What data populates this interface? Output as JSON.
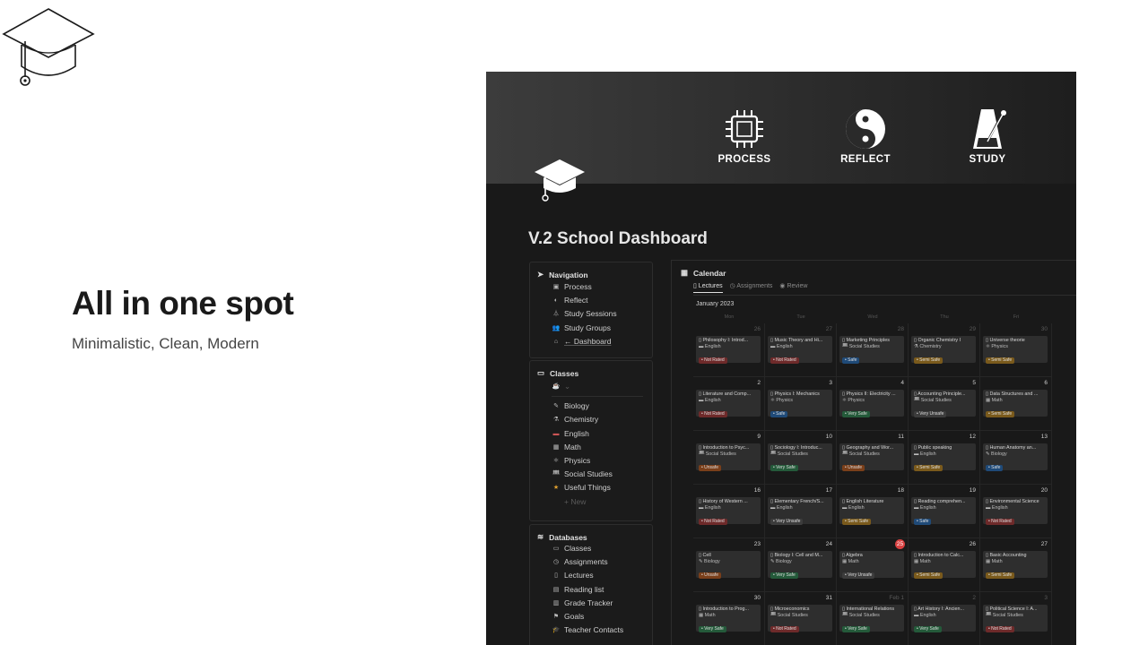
{
  "hero": {
    "title": "All in one spot",
    "subtitle": "Minimalistic, Clean, Modern"
  },
  "cover": {
    "items": [
      {
        "label": "PROCESS",
        "icon": "chip-icon"
      },
      {
        "label": "REFLECT",
        "icon": "yin-yang-icon"
      },
      {
        "label": "STUDY",
        "icon": "metronome-icon"
      }
    ]
  },
  "page": {
    "title": "V.2 School Dashboard"
  },
  "navigation": {
    "heading": "Navigation",
    "items": [
      {
        "label": "Process",
        "icon": "chip-icon"
      },
      {
        "label": "Reflect",
        "icon": "yin-yang-icon"
      },
      {
        "label": "Study Sessions",
        "icon": "metronome-icon"
      },
      {
        "label": "Study Groups",
        "icon": "people-icon"
      },
      {
        "label": "← Dashboard",
        "icon": "home-icon"
      }
    ]
  },
  "classes": {
    "heading": "Classes",
    "toggle": "⌄",
    "items": [
      {
        "label": "Biology",
        "icon": "pen-icon"
      },
      {
        "label": "Chemistry",
        "icon": "flask-icon"
      },
      {
        "label": "English",
        "icon": "flag-icon"
      },
      {
        "label": "Math",
        "icon": "calculator-icon"
      },
      {
        "label": "Physics",
        "icon": "atom-icon"
      },
      {
        "label": "Social Studies",
        "icon": "people-icon"
      },
      {
        "label": "Useful Things",
        "icon": "star-icon"
      }
    ],
    "new": "+ New"
  },
  "databases": {
    "heading": "Databases",
    "items": [
      {
        "label": "Classes",
        "icon": "monitor-icon"
      },
      {
        "label": "Assignments",
        "icon": "clock-icon"
      },
      {
        "label": "Lectures",
        "icon": "page-icon"
      },
      {
        "label": "Reading list",
        "icon": "book-icon"
      },
      {
        "label": "Grade Tracker",
        "icon": "notebook-icon"
      },
      {
        "label": "Goals",
        "icon": "flag-icon"
      },
      {
        "label": "Teacher Contacts",
        "icon": "graduation-cap-icon"
      }
    ]
  },
  "calendar": {
    "title": "Calendar",
    "tabs": [
      "Lectures",
      "Assignments",
      "Review"
    ],
    "month": "January 2023",
    "weekdays": [
      "Mon",
      "Tue",
      "Wed",
      "Thu",
      "Fri"
    ],
    "today": "25",
    "weeks": [
      [
        {
          "day": "26",
          "title": "Philosophy I: Introd...",
          "subject": "English",
          "status": "Not Rated"
        },
        {
          "day": "27",
          "title": "Music Theory and Hi...",
          "subject": "English",
          "status": "Not Rated"
        },
        {
          "day": "28",
          "title": "Marketing Principles",
          "subject": "Social Studies",
          "status": "Safe"
        },
        {
          "day": "29",
          "title": "Organic Chemistry I",
          "subject": "Chemistry",
          "status": "Semi Safe"
        },
        {
          "day": "30",
          "title": "Universe theorie",
          "subject": "Physics",
          "status": "Semi Safe"
        }
      ],
      [
        {
          "day": "2",
          "title": "Literature and Comp...",
          "subject": "English",
          "status": "Not Rated"
        },
        {
          "day": "3",
          "title": "Physics I: Mechanics",
          "subject": "Physics",
          "status": "Safe"
        },
        {
          "day": "4",
          "title": "Physics II: Electricity ...",
          "subject": "Physics",
          "status": "Very Safe"
        },
        {
          "day": "5",
          "title": "Accounting Principle...",
          "subject": "Social Studies",
          "status": "Very Unsafe"
        },
        {
          "day": "6",
          "title": "Data Structures and ...",
          "subject": "Math",
          "status": "Semi Safe"
        }
      ],
      [
        {
          "day": "9",
          "title": "Introduction to Psyc...",
          "subject": "Social Studies",
          "status": "Unsafe"
        },
        {
          "day": "10",
          "title": "Sociology I: Introduc...",
          "subject": "Social Studies",
          "status": "Very Safe"
        },
        {
          "day": "11",
          "title": "Geography and Wor...",
          "subject": "Social Studies",
          "status": "Unsafe"
        },
        {
          "day": "12",
          "title": "Public speaking",
          "subject": "English",
          "status": "Semi Safe"
        },
        {
          "day": "13",
          "title": "Human Anatomy an...",
          "subject": "Biology",
          "status": "Safe"
        }
      ],
      [
        {
          "day": "16",
          "title": "History of Western ...",
          "subject": "English",
          "status": "Not Rated"
        },
        {
          "day": "17",
          "title": "Elementary French/S...",
          "subject": "English",
          "status": "Very Unsafe"
        },
        {
          "day": "18",
          "title": "English Literature",
          "subject": "English",
          "status": "Semi Safe"
        },
        {
          "day": "19",
          "title": "Reading comprehen...",
          "subject": "English",
          "status": "Safe"
        },
        {
          "day": "20",
          "title": "Environmental Science",
          "subject": "English",
          "status": "Not Rated"
        }
      ],
      [
        {
          "day": "23",
          "title": "Cell",
          "subject": "Biology",
          "status": "Unsafe"
        },
        {
          "day": "24",
          "title": "Biology I: Cell and M...",
          "subject": "Biology",
          "status": "Very Safe"
        },
        {
          "day": "25",
          "title": "Algebra",
          "subject": "Math",
          "status": "Very Unsafe"
        },
        {
          "day": "26",
          "title": "Introduction to Calc...",
          "subject": "Math",
          "status": "Semi Safe"
        },
        {
          "day": "27",
          "title": "Basic Accounting",
          "subject": "Math",
          "status": "Semi Safe"
        }
      ],
      [
        {
          "day": "30",
          "title": "Introduction to Prog...",
          "subject": "Math",
          "status": "Very Safe"
        },
        {
          "day": "31",
          "title": "Microeconomics",
          "subject": "Social Studies",
          "status": "Not Rated"
        },
        {
          "day": "Feb 1",
          "title": "International Relations",
          "subject": "Social Studies",
          "status": "Very Safe"
        },
        {
          "day": "2",
          "title": "Art History I: Ancien...",
          "subject": "English",
          "status": "Very Safe"
        },
        {
          "day": "3",
          "title": "Political Science I: A...",
          "subject": "Social Studies",
          "status": "Not Rated"
        }
      ]
    ]
  },
  "colors": {
    "not_rated": "#6e2a2a",
    "semi_safe": "#7a5a1c",
    "safe": "#1f4a78",
    "very_safe": "#245a3a",
    "unsafe": "#7a3f1a",
    "very_unsafe": "#3c3c3c",
    "today": "#d94141"
  }
}
